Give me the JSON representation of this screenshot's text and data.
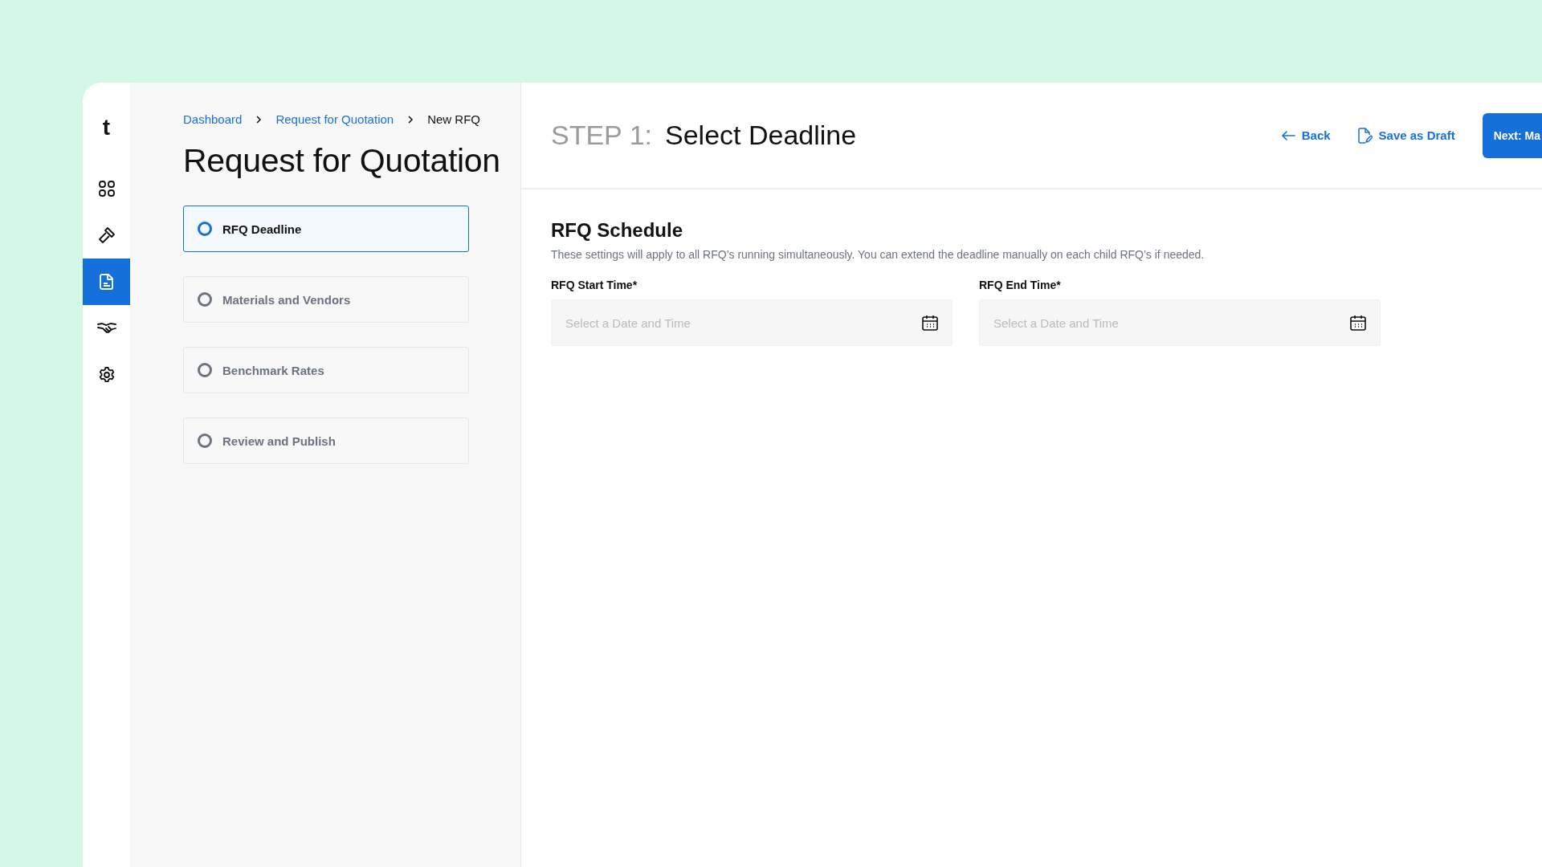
{
  "nav": {
    "logo": "t",
    "items": [
      {
        "kind": "grid",
        "selected": false
      },
      {
        "kind": "gavel",
        "selected": false
      },
      {
        "kind": "document",
        "selected": true
      },
      {
        "kind": "handshake",
        "selected": false
      },
      {
        "kind": "gear",
        "selected": false
      }
    ]
  },
  "breadcrumb": [
    {
      "label": "Dashboard",
      "current": false
    },
    {
      "label": "Request for Quotation",
      "current": false
    },
    {
      "label": "New RFQ",
      "current": true
    }
  ],
  "page_title": "Request for Quotation",
  "steps": [
    {
      "label": "RFQ Deadline",
      "selected": true
    },
    {
      "label": "Materials and Vendors",
      "selected": false
    },
    {
      "label": "Benchmark Rates",
      "selected": false
    },
    {
      "label": "Review and Publish",
      "selected": false
    }
  ],
  "header": {
    "step": "STEP 1:",
    "title": "Select Deadline",
    "back": "Back",
    "save_draft": "Save as Draft",
    "next": "Next: Ma"
  },
  "section": {
    "title": "RFQ Schedule",
    "description": "These settings will apply to all RFQ’s running simultaneously. You can extend the deadline manually on each child RFQ’s if needed.",
    "fields": [
      {
        "label": "RFQ Start Time*",
        "placeholder": "Select a Date and Time"
      },
      {
        "label": "RFQ End Time*",
        "placeholder": "Select a Date and Time"
      }
    ]
  }
}
